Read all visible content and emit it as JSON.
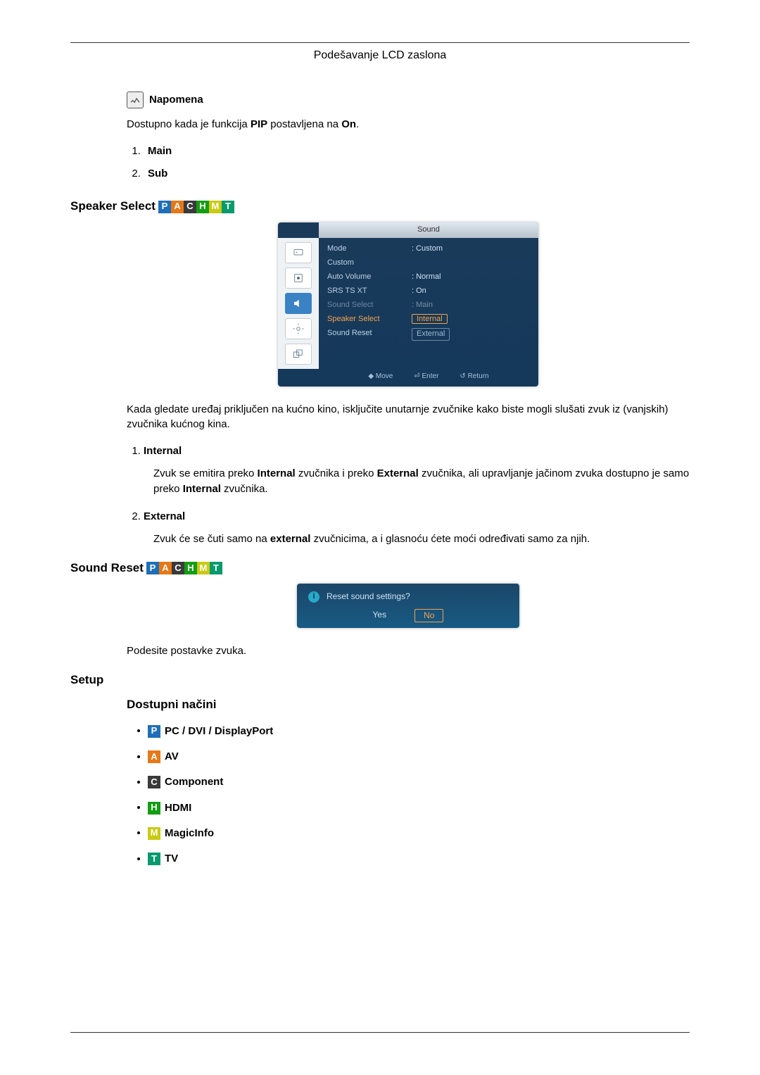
{
  "header": {
    "title": "Podešavanje LCD zaslona"
  },
  "note": {
    "label": "Napomena",
    "text_pre": "Dostupno kada je funkcija ",
    "pip": "PIP",
    "text_mid": " postavljena na ",
    "on": "On",
    "dot": "."
  },
  "pip_list": {
    "item1": "Main",
    "item2": "Sub"
  },
  "speaker": {
    "heading": "Speaker Select",
    "modes": [
      "P",
      "A",
      "C",
      "H",
      "M",
      "T"
    ],
    "osd": {
      "title": "Sound",
      "rows": {
        "mode_l": "Mode",
        "mode_v": ": Custom",
        "custom_l": "Custom",
        "auto_l": "Auto Volume",
        "auto_v": ": Normal",
        "srs_l": "SRS TS XT",
        "srs_v": ": On",
        "sel_l": "Sound Select",
        "sel_v": ": Main",
        "spk_l": "Speaker Select",
        "spk_v1": "Internal",
        "spk_v2": "External",
        "reset_l": "Sound Reset"
      },
      "footer": {
        "move": "Move",
        "enter": "Enter",
        "return": "Return"
      }
    },
    "intro": "Kada gledate uređaj priključen na kućno kino, isključite unutarnje zvučnike kako biste mogli slušati zvuk iz (vanjskih) zvučnika kućnog kina.",
    "opt1": {
      "title": "Internal",
      "body_pre": "Zvuk se emitira preko ",
      "b1": "Internal",
      "mid1": " zvučnika i preko ",
      "b2": "External",
      "mid2": " zvučnika, ali upravljanje jačinom zvuka dostupno je samo preko ",
      "b3": "Internal",
      "tail": " zvučnika."
    },
    "opt2": {
      "title": "External",
      "body_pre": "Zvuk će se čuti samo na ",
      "b1": "external",
      "tail": " zvučnicima, a i glasnoću ćete moći određivati samo za njih."
    }
  },
  "sound_reset": {
    "heading": "Sound Reset",
    "modes": [
      "P",
      "A",
      "C",
      "H",
      "M",
      "T"
    ],
    "dialog": {
      "question": "Reset sound settings?",
      "yes": "Yes",
      "no": "No"
    },
    "body": "Podesite postavke zvuka."
  },
  "setup": {
    "heading": "Setup",
    "subheading": "Dostupni načini",
    "items": [
      {
        "box": "P",
        "cls": "m-P",
        "label": "PC / DVI / DisplayPort"
      },
      {
        "box": "A",
        "cls": "m-A",
        "label": "AV"
      },
      {
        "box": "C",
        "cls": "m-C",
        "label": "Component"
      },
      {
        "box": "H",
        "cls": "m-H",
        "label": "HDMI"
      },
      {
        "box": "M",
        "cls": "m-M",
        "label": "MagicInfo"
      },
      {
        "box": "T",
        "cls": "m-T",
        "label": "TV"
      }
    ]
  }
}
